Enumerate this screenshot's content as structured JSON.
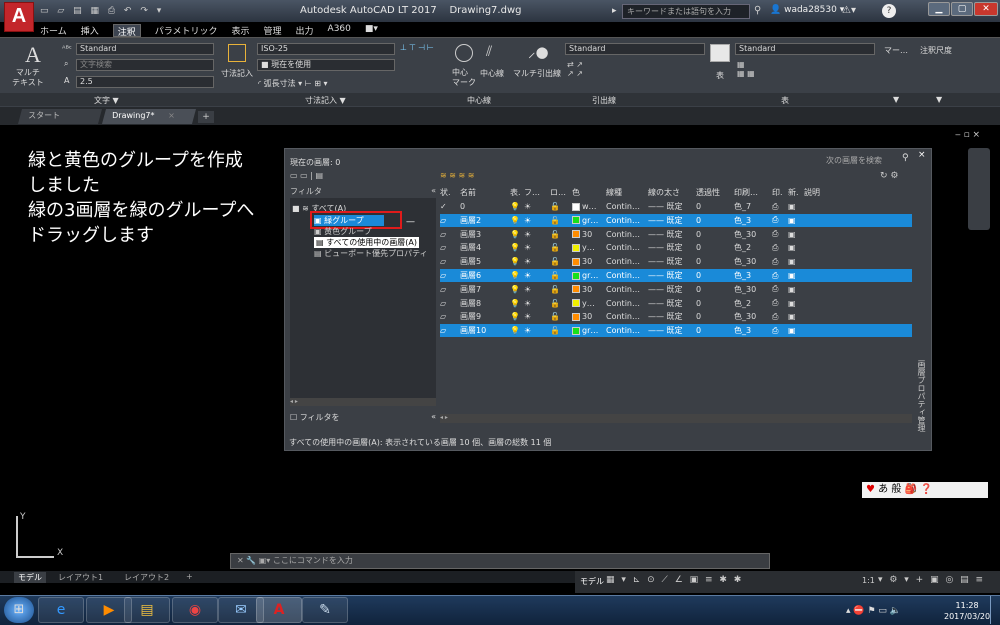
{
  "window": {
    "title": "Autodesk AutoCAD LT 2017",
    "document": "Drawing7.dwg",
    "app_logo": "A",
    "app_logo_sub": "LT"
  },
  "search": {
    "placeholder": "キーワードまたは語句を入力"
  },
  "user": {
    "name": "wada28530"
  },
  "menu_tabs": [
    "ホーム",
    "挿入",
    "注釈",
    "パラメトリック",
    "表示",
    "管理",
    "出力",
    "A360"
  ],
  "ribbon": {
    "text_style": "Standard",
    "text_search_placeholder": "文字検索",
    "text_height": "2.5",
    "multiline_text": "マルチ\nテキスト",
    "dim_label": "寸法記入",
    "dim_style": "ISO-25",
    "dim_layer": "現在を使用",
    "arc_length": "弧長寸法",
    "center_mark": "中心\nマーク",
    "center_line": "中心線",
    "multileader": "マルチ引出線",
    "leader_style": "Standard",
    "table_label": "表",
    "table_style": "Standard",
    "mark_label": "マー…",
    "annot_scale": "注釈尺度",
    "panels": [
      "文字 ▼",
      "寸法記入 ▼",
      "中心線",
      "引出線",
      "表",
      "▼",
      "▼"
    ]
  },
  "doc_tabs": [
    "スタート",
    "Drawing7*"
  ],
  "note": "緑と黄色のグループを作成\nしました\n緑の3画層を緑のグループへ\nドラッグします",
  "palette": {
    "current_layer": "現在の画層: 0",
    "search_placeholder": "次の画層を検索",
    "filter_header": "フィルタ",
    "tree": [
      "すべて(A)",
      "緑グループ",
      "黄色グループ",
      "すべての使用中の画層(A)",
      "ビューポート優先プロパティ"
    ],
    "invert_filter": "フィルタを",
    "side_title": "画層プロパティ管理",
    "status": "すべての使用中の画層(A): 表示されている画層 10 個、画層の総数 11 個",
    "columns": [
      "状.",
      "名前",
      "表.",
      "フ…",
      "ロ…",
      "色",
      "線種",
      "線の太さ",
      "透過性",
      "印刷…",
      "印.",
      "新.",
      "説明"
    ],
    "layers": [
      {
        "name": "0",
        "color_name": "w…",
        "color": "#ffffff",
        "linetype": "Contin…",
        "lw": "—— 既定",
        "tr": "0",
        "plot": "色_7",
        "sel": false
      },
      {
        "name": "画層2",
        "color_name": "gr…",
        "color": "#19e019",
        "linetype": "Contin…",
        "lw": "—— 既定",
        "tr": "0",
        "plot": "色_3",
        "sel": true
      },
      {
        "name": "画層3",
        "color_name": "30",
        "color": "#ff8c00",
        "linetype": "Contin…",
        "lw": "—— 既定",
        "tr": "0",
        "plot": "色_30",
        "sel": false
      },
      {
        "name": "画層4",
        "color_name": "y…",
        "color": "#f0f000",
        "linetype": "Contin…",
        "lw": "—— 既定",
        "tr": "0",
        "plot": "色_2",
        "sel": false
      },
      {
        "name": "画層5",
        "color_name": "30",
        "color": "#ff8c00",
        "linetype": "Contin…",
        "lw": "—— 既定",
        "tr": "0",
        "plot": "色_30",
        "sel": false
      },
      {
        "name": "画層6",
        "color_name": "gr…",
        "color": "#19e019",
        "linetype": "Contin…",
        "lw": "—— 既定",
        "tr": "0",
        "plot": "色_3",
        "sel": true
      },
      {
        "name": "画層7",
        "color_name": "30",
        "color": "#ff8c00",
        "linetype": "Contin…",
        "lw": "—— 既定",
        "tr": "0",
        "plot": "色_30",
        "sel": false
      },
      {
        "name": "画層8",
        "color_name": "y…",
        "color": "#f0f000",
        "linetype": "Contin…",
        "lw": "—— 既定",
        "tr": "0",
        "plot": "色_2",
        "sel": false
      },
      {
        "name": "画層9",
        "color_name": "30",
        "color": "#ff8c00",
        "linetype": "Contin…",
        "lw": "—— 既定",
        "tr": "0",
        "plot": "色_30",
        "sel": false
      },
      {
        "name": "画層10",
        "color_name": "gr…",
        "color": "#19e019",
        "linetype": "Contin…",
        "lw": "—— 既定",
        "tr": "0",
        "plot": "色_3",
        "sel": true
      }
    ]
  },
  "ime": {
    "text": "あ 般"
  },
  "command": {
    "placeholder": "ここにコマンドを入力"
  },
  "layout_tabs": [
    "モデル",
    "レイアウト1",
    "レイアウト2"
  ],
  "status": {
    "model": "モデル",
    "scale": "1:1"
  },
  "clock": {
    "time": "11:28",
    "date": "2017/03/20"
  },
  "colors": {
    "accent": "#1a8ad8",
    "highlight_box": "#e01b1b"
  }
}
